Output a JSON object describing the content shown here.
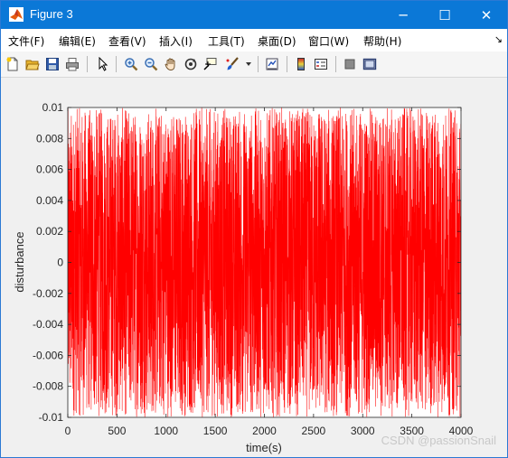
{
  "window": {
    "title": "Figure 3"
  },
  "titlebar": {
    "minimize_glyph": "─",
    "maximize_glyph": "☐",
    "close_glyph": "✕"
  },
  "menu": {
    "items": [
      {
        "label": "文件(F)"
      },
      {
        "label": "编辑(E)"
      },
      {
        "label": "查看(V)"
      },
      {
        "label": "插入(I)"
      },
      {
        "label": "工具(T)"
      },
      {
        "label": "桌面(D)"
      },
      {
        "label": "窗口(W)"
      },
      {
        "label": "帮助(H)"
      }
    ],
    "more_glyph": "↘"
  },
  "toolbar": {
    "icons": [
      "new-figure-icon",
      "open-file-icon",
      "save-icon",
      "print-icon",
      "pointer-icon",
      "zoom-in-icon",
      "zoom-out-icon",
      "pan-icon",
      "rotate-3d-icon",
      "data-cursor-icon",
      "brush-icon",
      "brush-dropdown-icon",
      "link-plot-icon",
      "colorbar-icon",
      "legend-icon",
      "hide-plot-tools-icon",
      "show-plot-tools-icon"
    ]
  },
  "colors": {
    "titlebar": "#0b78d7",
    "line": "#ff0000",
    "watermark": "#c8c8c8"
  },
  "watermark": "CSDN @passionSnail",
  "chart_data": {
    "type": "line",
    "xlabel": "time(s)",
    "ylabel": "disturbance",
    "xlim": [
      0,
      4000
    ],
    "ylim": [
      -0.01,
      0.01
    ],
    "xticks": [
      "0",
      "500",
      "1000",
      "1500",
      "2000",
      "2500",
      "3000",
      "3500",
      "4000"
    ],
    "yticks": [
      "-0.01",
      "-0.008",
      "-0.006",
      "-0.004",
      "-0.002",
      "0",
      "0.002",
      "0.004",
      "0.006",
      "0.008",
      "0.01"
    ],
    "series": [
      {
        "color": "#ff0000",
        "description": "uniform random noise",
        "samples": 4001,
        "min": -0.01,
        "max": 0.01
      }
    ],
    "grid": false
  }
}
